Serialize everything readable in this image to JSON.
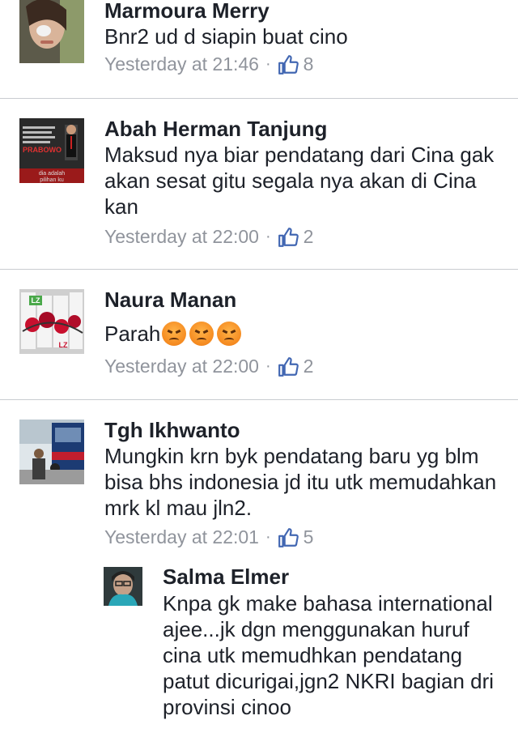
{
  "comments": [
    {
      "author": "Marmoura Merry",
      "text": "Bnr2 ud d siapin buat cino",
      "time": "Yesterday at 21:46",
      "likes": "8"
    },
    {
      "author": "Abah Herman Tanjung",
      "text": "Maksud nya biar pendatang dari Cina gak akan sesat gitu segala nya akan di Cina kan",
      "time": "Yesterday at 22:00",
      "likes": "2",
      "avatar_text": "dia adalah pilihan ku"
    },
    {
      "author": "Naura Manan",
      "text": "Parah",
      "time": "Yesterday at 22:00",
      "likes": "2",
      "avatar_text": "LZ"
    },
    {
      "author": "Tgh Ikhwanto",
      "text": "Mungkin krn byk pendatang baru yg blm bisa bhs indonesia jd itu utk memudahkan mrk kl mau jln2.",
      "time": "Yesterday at 22:01",
      "likes": "5"
    }
  ],
  "reply": {
    "author": "Salma Elmer",
    "text": "Knpa gk make bahasa international ajee...jk dgn menggunakan huruf cina utk memudhkan pendatang patut dicurigai,jgn2 NKRI bagian dri provinsi cinoo"
  },
  "separator": "·",
  "icons": {
    "like": "thumbs-up-icon",
    "emoji": "angry-face-icon"
  },
  "colors": {
    "meta": "#90949c",
    "like_blue": "#4267b2",
    "divider": "#c9ccd1"
  }
}
